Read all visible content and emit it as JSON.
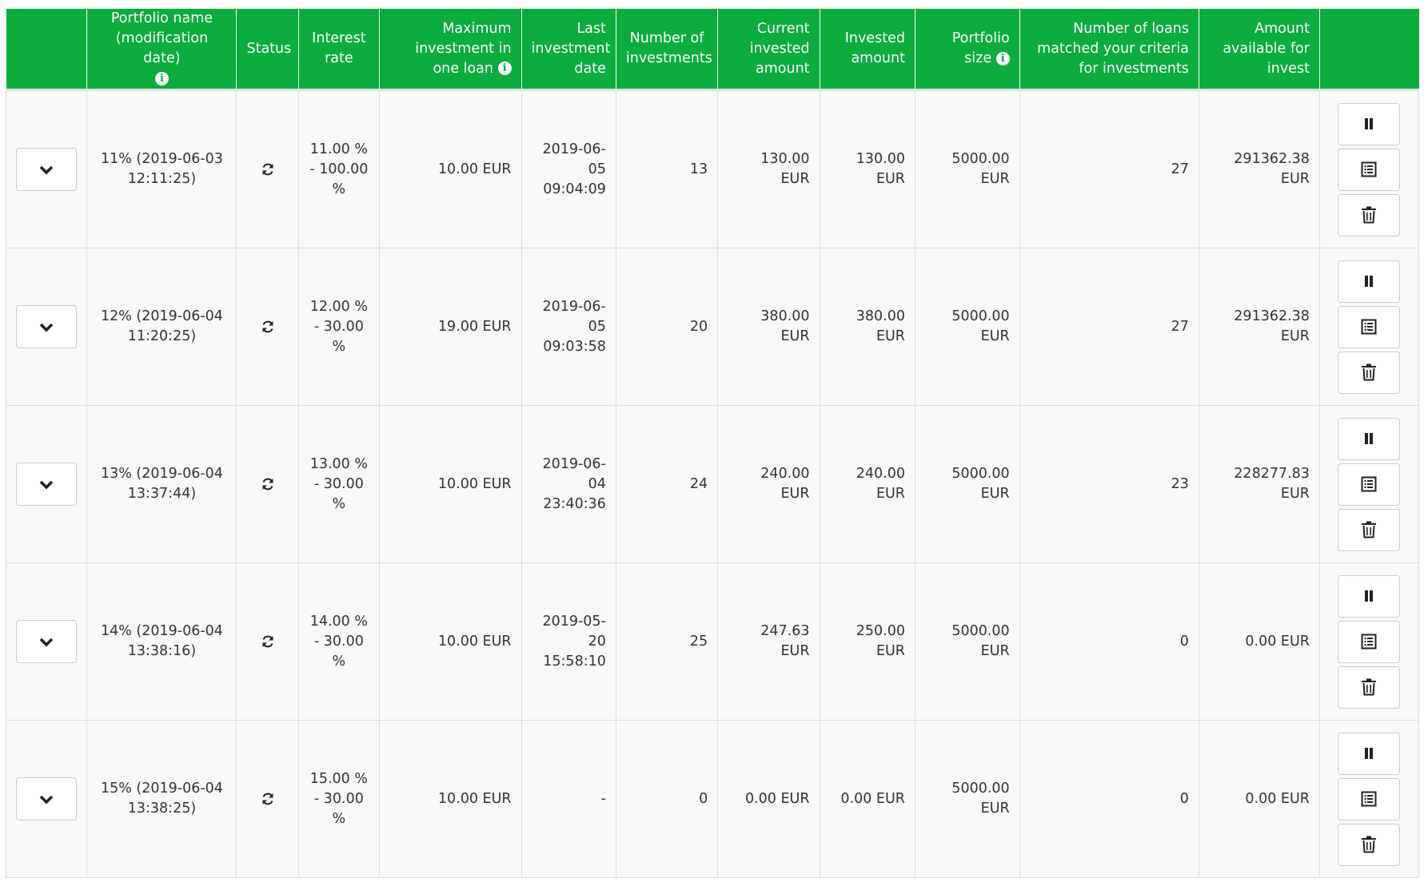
{
  "table": {
    "headers": {
      "portfolio_name": "Portfolio name (modification date)",
      "status": "Status",
      "interest_rate": "Interest rate",
      "max_investment": "Maximum investment in one loan",
      "last_investment": "Last investment date",
      "num_investments": "Number of investments",
      "current_invested": "Current invested amount",
      "invested": "Invested amount",
      "portfolio_size": "Portfolio size",
      "num_loans": "Number of loans matched your criteria for investments",
      "amount_available": "Amount available for invest"
    },
    "rows": [
      {
        "name": "11% (2019-06-03 12:11:25)",
        "rate": "11.00 % - 100.00 %",
        "max": "10.00 EUR",
        "last": "2019-06-05 09:04:09",
        "count": "13",
        "current": "130.00 EUR",
        "invested": "130.00 EUR",
        "size": "5000.00 EUR",
        "loans": "27",
        "available": "291362.38 EUR"
      },
      {
        "name": "12% (2019-06-04 11:20:25)",
        "rate": "12.00 % - 30.00 %",
        "max": "19.00 EUR",
        "last": "2019-06-05 09:03:58",
        "count": "20",
        "current": "380.00 EUR",
        "invested": "380.00 EUR",
        "size": "5000.00 EUR",
        "loans": "27",
        "available": "291362.38 EUR"
      },
      {
        "name": "13% (2019-06-04 13:37:44)",
        "rate": "13.00 % - 30.00 %",
        "max": "10.00 EUR",
        "last": "2019-06-04 23:40:36",
        "count": "24",
        "current": "240.00 EUR",
        "invested": "240.00 EUR",
        "size": "5000.00 EUR",
        "loans": "23",
        "available": "228277.83 EUR"
      },
      {
        "name": "14% (2019-06-04 13:38:16)",
        "rate": "14.00 % - 30.00 %",
        "max": "10.00 EUR",
        "last": "2019-05-20 15:58:10",
        "count": "25",
        "current": "247.63 EUR",
        "invested": "250.00 EUR",
        "size": "5000.00 EUR",
        "loans": "0",
        "available": "0.00 EUR"
      },
      {
        "name": "15% (2019-06-04 13:38:25)",
        "rate": "15.00 % - 30.00 %",
        "max": "10.00 EUR",
        "last": "-",
        "count": "0",
        "current": "0.00 EUR",
        "invested": "0.00 EUR",
        "size": "5000.00 EUR",
        "loans": "0",
        "available": "0.00 EUR"
      }
    ]
  },
  "icons": {
    "expand": "chevron-down-icon",
    "status": "refresh-icon",
    "info": "info-icon",
    "pause": "pause-icon",
    "details": "list-icon",
    "delete": "trash-icon"
  },
  "colors": {
    "header_bg": "#0cac3f",
    "row_bg": "#f9f9f9"
  }
}
